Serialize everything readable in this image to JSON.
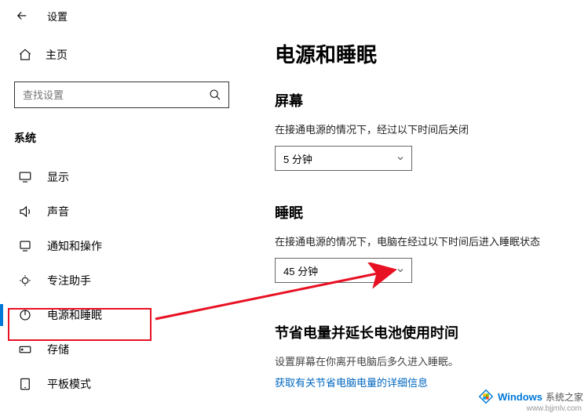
{
  "header": {
    "app_title": "设置"
  },
  "sidebar": {
    "home_label": "主页",
    "search_placeholder": "查找设置",
    "category_label": "系统",
    "items": [
      {
        "label": "显示"
      },
      {
        "label": "声音"
      },
      {
        "label": "通知和操作"
      },
      {
        "label": "专注助手"
      },
      {
        "label": "电源和睡眠"
      },
      {
        "label": "存储"
      },
      {
        "label": "平板模式"
      }
    ]
  },
  "main": {
    "page_title": "电源和睡眠",
    "screen_title": "屏幕",
    "screen_desc": "在接通电源的情况下，经过以下时间后关闭",
    "screen_value": "5 分钟",
    "sleep_title": "睡眠",
    "sleep_desc": "在接通电源的情况下，电脑在经过以下时间后进入睡眠状态",
    "sleep_value": "45 分钟",
    "save_title": "节省电量并延长电池使用时间",
    "save_desc": "设置屏幕在你离开电脑后多久进入睡眠。",
    "save_link": "获取有关节省电脑电量的详细信息"
  },
  "watermark": {
    "brand": "Windows",
    "suffix": "系统之家",
    "url": "www.bjjmlv.com"
  }
}
